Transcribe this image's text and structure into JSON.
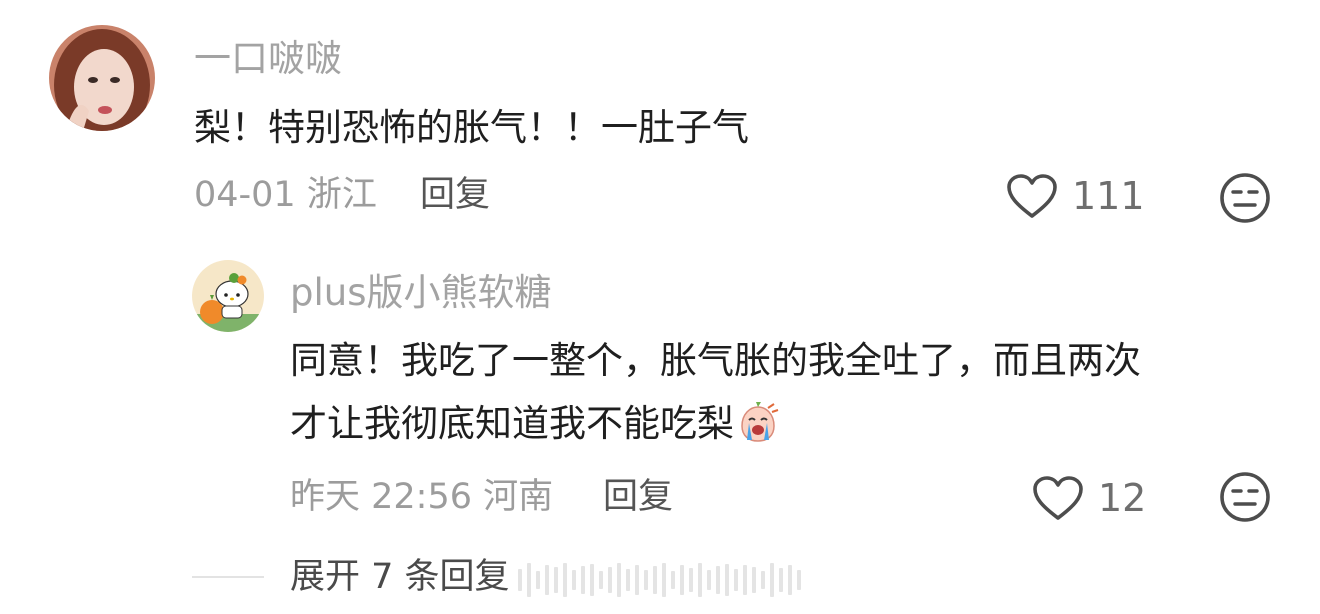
{
  "comment": {
    "username": "一口啵啵",
    "text": "梨！特别恐怖的胀气！！一肚子气",
    "meta": "04-01 浙江",
    "reply_label": "回复",
    "like_count": "111"
  },
  "reply": {
    "username": "plus版小熊软糖",
    "text_line1": "同意！我吃了一整个，胀气胀的我全吐了，而且两次",
    "text_line2": "才让我彻底知道我不能吃梨",
    "meta": "昨天 22:56 河南",
    "reply_label": "回复",
    "like_count": "12"
  },
  "expand": {
    "label": "展开 7 条回复"
  },
  "icons": {
    "like": "heart-outline-icon",
    "dislike": "neutral-face-icon",
    "emoji": "crying-face-emoji"
  },
  "colors": {
    "text": "#1f1f1f",
    "secondary": "#a3a3a3",
    "icon": "#555555"
  }
}
